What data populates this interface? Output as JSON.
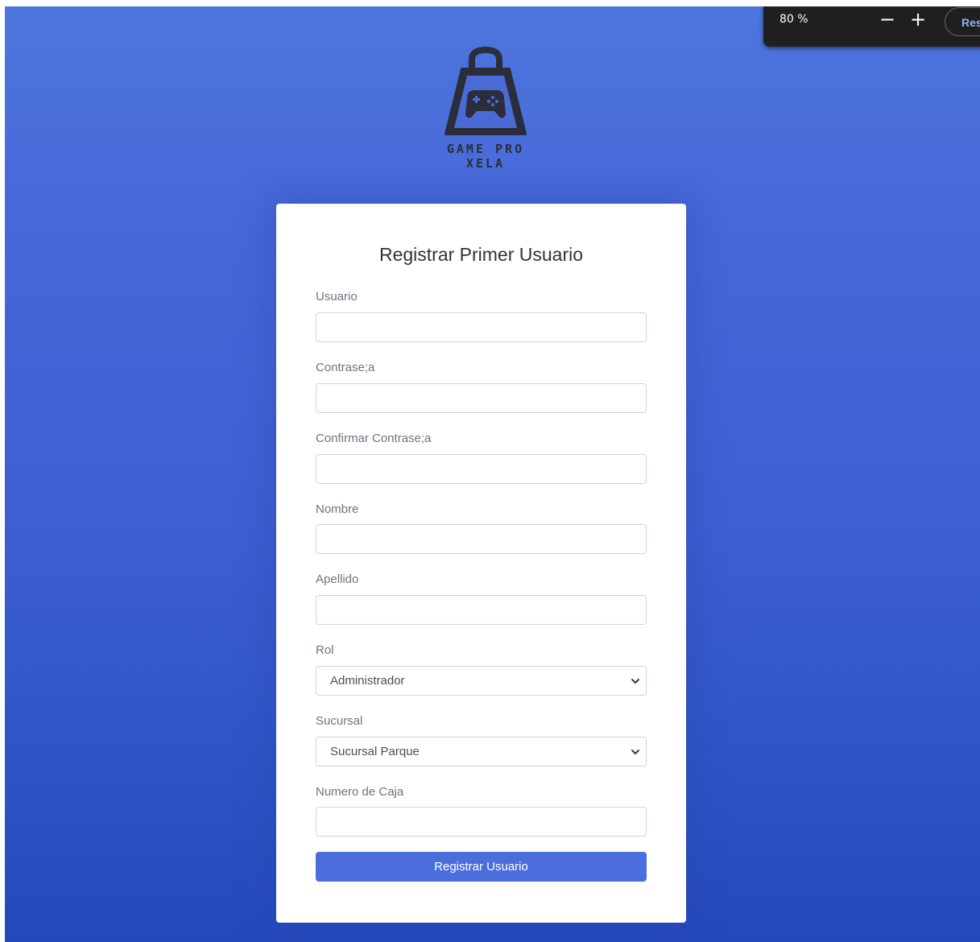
{
  "zoom": {
    "level": "80 %",
    "minus_label": "−",
    "plus_label": "+",
    "reset_label": "Res"
  },
  "brand": {
    "name": "GAME PRO XELA",
    "logo_icon": "shopping-bag-gamepad-icon"
  },
  "form": {
    "title": "Registrar Primer Usuario",
    "fields": [
      {
        "label": "Usuario",
        "value": ""
      },
      {
        "label": "Contrase;a",
        "value": ""
      },
      {
        "label": "Confirmar Contrase;a",
        "value": ""
      },
      {
        "label": "Nombre",
        "value": ""
      },
      {
        "label": "Apellido",
        "value": ""
      },
      {
        "label": "Rol",
        "value": "Administrador"
      },
      {
        "label": "Sucursal",
        "value": "Sucursal Parque"
      },
      {
        "label": "Numero de Caja",
        "value": ""
      }
    ],
    "submit_label": "Registrar Usuario"
  },
  "colors": {
    "accent": "#4a6fdc",
    "background_top": "#4c76dd",
    "background_bottom": "#2349bb"
  }
}
